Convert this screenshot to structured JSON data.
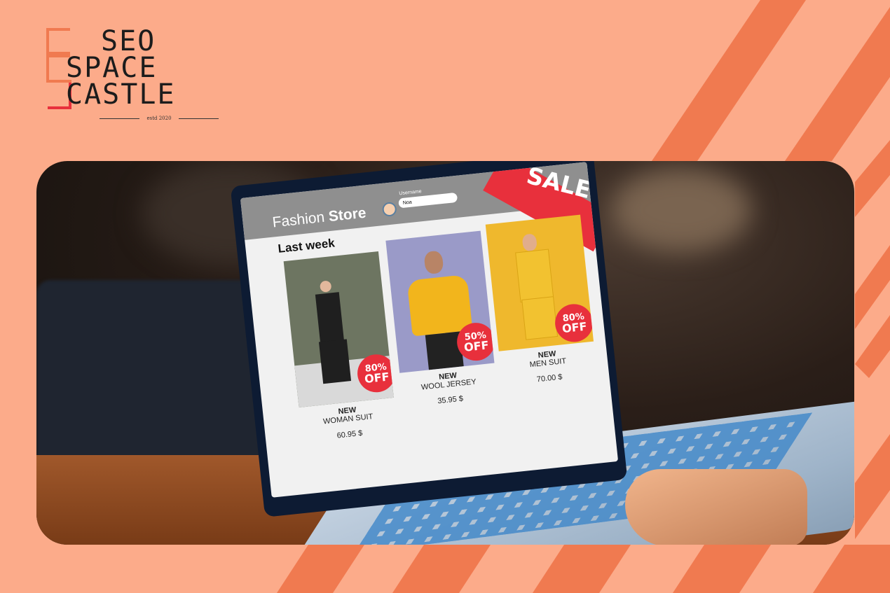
{
  "logo": {
    "line1": "SEO",
    "line2": "SPACE",
    "line3": "CASTLE",
    "tagline": "estd 2020"
  },
  "store": {
    "title_light": "Fashion",
    "title_bold": "Store",
    "username_label": "Username",
    "username_value": "Noa",
    "sale_label": "SALE",
    "section_title": "Last week"
  },
  "products": [
    {
      "tag": "NEW",
      "name": "WOMAN SUIT",
      "price": "60.95 $",
      "discount": "80%",
      "off": "OFF",
      "bg": "#6d7561",
      "outfit": "#1f1f1f"
    },
    {
      "tag": "NEW",
      "name": "WOOL JERSEY",
      "price": "35.95 $",
      "discount": "50%",
      "off": "OFF",
      "bg": "#9a9ac8",
      "outfit": "#f2b51c"
    },
    {
      "tag": "NEW",
      "name": "MEN SUIT",
      "price": "70.00 $",
      "discount": "80%",
      "off": "OFF",
      "bg": "#efb82d",
      "outfit": "#f2c230"
    }
  ],
  "colors": {
    "background": "#fcab8a",
    "stripe": "#f07a50",
    "accent_red": "#e8303c",
    "logo_orange": "#f07a50"
  }
}
